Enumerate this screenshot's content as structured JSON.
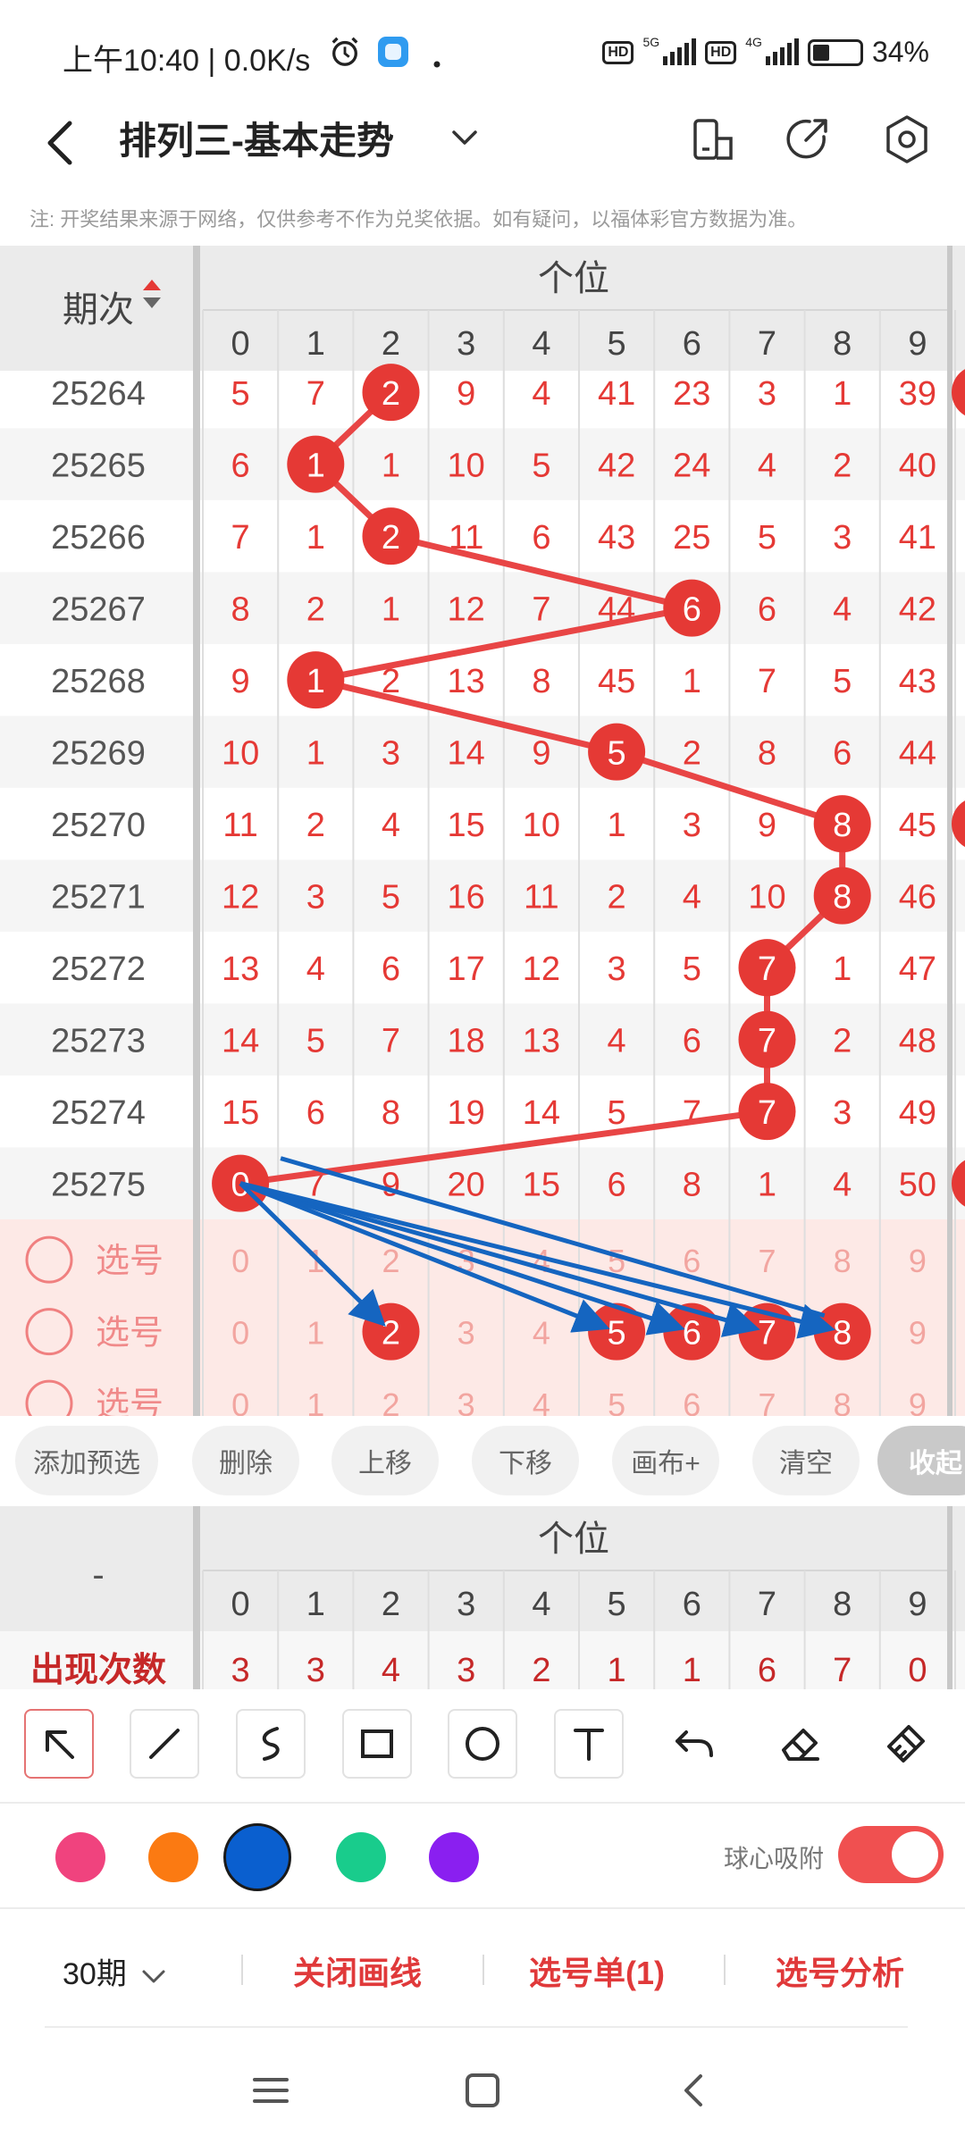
{
  "status_bar": {
    "time_speed": "上午10:40 | 0.0K/s",
    "hd1": "HD",
    "net1": "5G",
    "hd2": "HD",
    "net2": "4G",
    "battery": "34%"
  },
  "nav": {
    "title": "排列三-基本走势"
  },
  "notice": "注: 开奖结果来源于网络，仅供参考不作为兑奖依据。如有疑问，以福体彩官方数据为准。",
  "table": {
    "period_header": "期次",
    "position_header": "个位",
    "columns": [
      "0",
      "1",
      "2",
      "3",
      "4",
      "5",
      "6",
      "7",
      "8",
      "9"
    ],
    "rows": [
      {
        "period": "25264",
        "cells": [
          "5",
          "7",
          "2",
          "9",
          "4",
          "41",
          "23",
          "3",
          "1",
          "39"
        ],
        "hit": 2
      },
      {
        "period": "25265",
        "cells": [
          "6",
          "1",
          "1",
          "10",
          "5",
          "42",
          "24",
          "4",
          "2",
          "40"
        ],
        "hit": 1
      },
      {
        "period": "25266",
        "cells": [
          "7",
          "1",
          "2",
          "11",
          "6",
          "43",
          "25",
          "5",
          "3",
          "41"
        ],
        "hit": 2
      },
      {
        "period": "25267",
        "cells": [
          "8",
          "2",
          "1",
          "12",
          "7",
          "44",
          "6",
          "6",
          "4",
          "42"
        ],
        "hit": 6
      },
      {
        "period": "25268",
        "cells": [
          "9",
          "1",
          "2",
          "13",
          "8",
          "45",
          "1",
          "7",
          "5",
          "43"
        ],
        "hit": 1
      },
      {
        "period": "25269",
        "cells": [
          "10",
          "1",
          "3",
          "14",
          "9",
          "5",
          "2",
          "8",
          "6",
          "44"
        ],
        "hit": 5
      },
      {
        "period": "25270",
        "cells": [
          "11",
          "2",
          "4",
          "15",
          "10",
          "1",
          "3",
          "9",
          "8",
          "45"
        ],
        "hit": 8
      },
      {
        "period": "25271",
        "cells": [
          "12",
          "3",
          "5",
          "16",
          "11",
          "2",
          "4",
          "10",
          "8",
          "46"
        ],
        "hit": 8
      },
      {
        "period": "25272",
        "cells": [
          "13",
          "4",
          "6",
          "17",
          "12",
          "3",
          "5",
          "7",
          "1",
          "47"
        ],
        "hit": 7
      },
      {
        "period": "25273",
        "cells": [
          "14",
          "5",
          "7",
          "18",
          "13",
          "4",
          "6",
          "7",
          "2",
          "48"
        ],
        "hit": 7
      },
      {
        "period": "25274",
        "cells": [
          "15",
          "6",
          "8",
          "19",
          "14",
          "5",
          "7",
          "7",
          "3",
          "49"
        ],
        "hit": 7
      },
      {
        "period": "25275",
        "cells": [
          "0",
          "7",
          "9",
          "20",
          "15",
          "6",
          "8",
          "1",
          "4",
          "50"
        ],
        "hit": 0
      }
    ],
    "pick_label": "选号",
    "pick_rows": [
      {
        "cells": [
          "0",
          "1",
          "2",
          "3",
          "4",
          "5",
          "6",
          "7",
          "8",
          "9"
        ],
        "selected": []
      },
      {
        "cells": [
          "0",
          "1",
          "2",
          "3",
          "4",
          "5",
          "6",
          "7",
          "8",
          "9"
        ],
        "selected": [
          2,
          5,
          6,
          7,
          8
        ]
      },
      {
        "cells": [
          "0",
          "1",
          "2",
          "3",
          "4",
          "5",
          "6",
          "7",
          "8",
          "9"
        ],
        "selected": []
      }
    ]
  },
  "buttons": [
    "添加预选",
    "删除",
    "上移",
    "下移",
    "画布+",
    "清空",
    "收起"
  ],
  "stats": {
    "corner": "-",
    "position_header": "个位",
    "columns": [
      "0",
      "1",
      "2",
      "3",
      "4",
      "5",
      "6",
      "7",
      "8",
      "9"
    ],
    "row_label": "出现次数",
    "counts": [
      "3",
      "3",
      "4",
      "3",
      "2",
      "1",
      "1",
      "6",
      "7",
      "0"
    ]
  },
  "tools": [
    "arrow",
    "line",
    "curve",
    "rectangle",
    "circle",
    "text",
    "undo",
    "eraser",
    "clear"
  ],
  "palette": {
    "colors": [
      "#f0437e",
      "#fb7a12",
      "#0a5fcf",
      "#19cc8c",
      "#8a1ff0"
    ],
    "selected": "#0a5fcf",
    "snap_label": "球心吸附",
    "snap_on": true
  },
  "footer": {
    "period": "30期",
    "close_lines": "关闭画线",
    "pick_list": "选号单(1)",
    "pick_analysis": "选号分析"
  },
  "colors": {
    "accent_red": "#e84545",
    "ball_red": "#e53935",
    "draw_blue": "#1565c0",
    "pick_bg": "#fde9e6"
  }
}
